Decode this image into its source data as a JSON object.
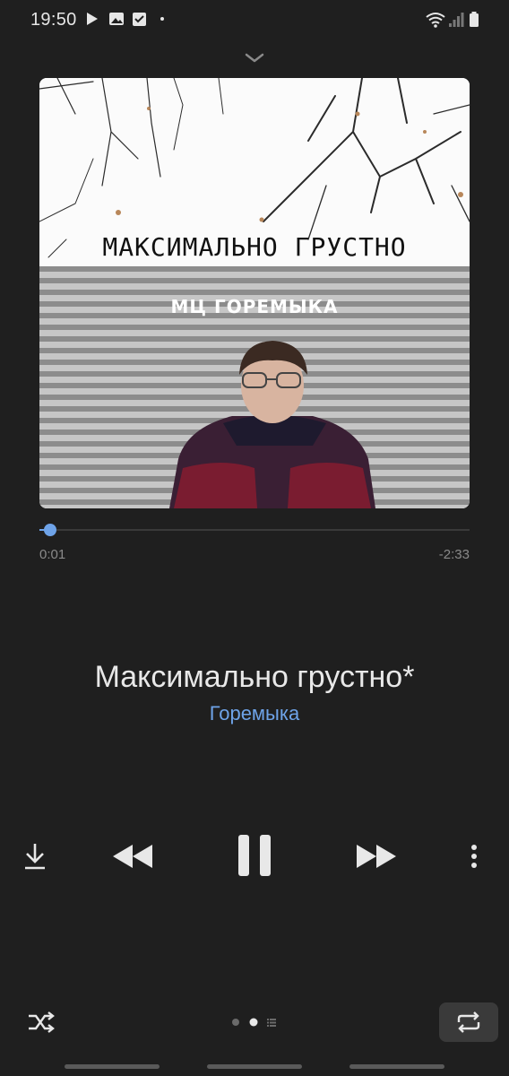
{
  "status_bar": {
    "time": "19:50",
    "left_icons": [
      "play-icon",
      "image-icon",
      "checkbox-icon",
      "dot-icon"
    ],
    "right_icons": [
      "wifi-icon",
      "signal-icon",
      "battery-icon"
    ]
  },
  "player": {
    "collapse_icon": "chevron-down-icon",
    "cover": {
      "title_text": "МАКСИМАЛЬНО ГРУСТНО",
      "artist_text": "МЦ ГОРЕМЫКА"
    },
    "progress": {
      "elapsed": "0:01",
      "remaining": "-2:33",
      "fraction": 0.025
    },
    "song_title": "Максимально грустно*",
    "artist": "Горемыка",
    "controls": [
      "download-icon",
      "rewind-icon",
      "pause-icon",
      "fast-forward-icon",
      "more-icon"
    ],
    "bottom": {
      "shuffle_icon": "shuffle-icon",
      "page_indicator": {
        "pages": 2,
        "active": 1,
        "extra": "queue-list-icon"
      },
      "repeat_icon": "repeat-icon"
    }
  },
  "colors": {
    "accent": "#6ea3e8",
    "background": "#1f1f1f",
    "text": "#e8e8e8",
    "muted": "#8a8a8a"
  }
}
